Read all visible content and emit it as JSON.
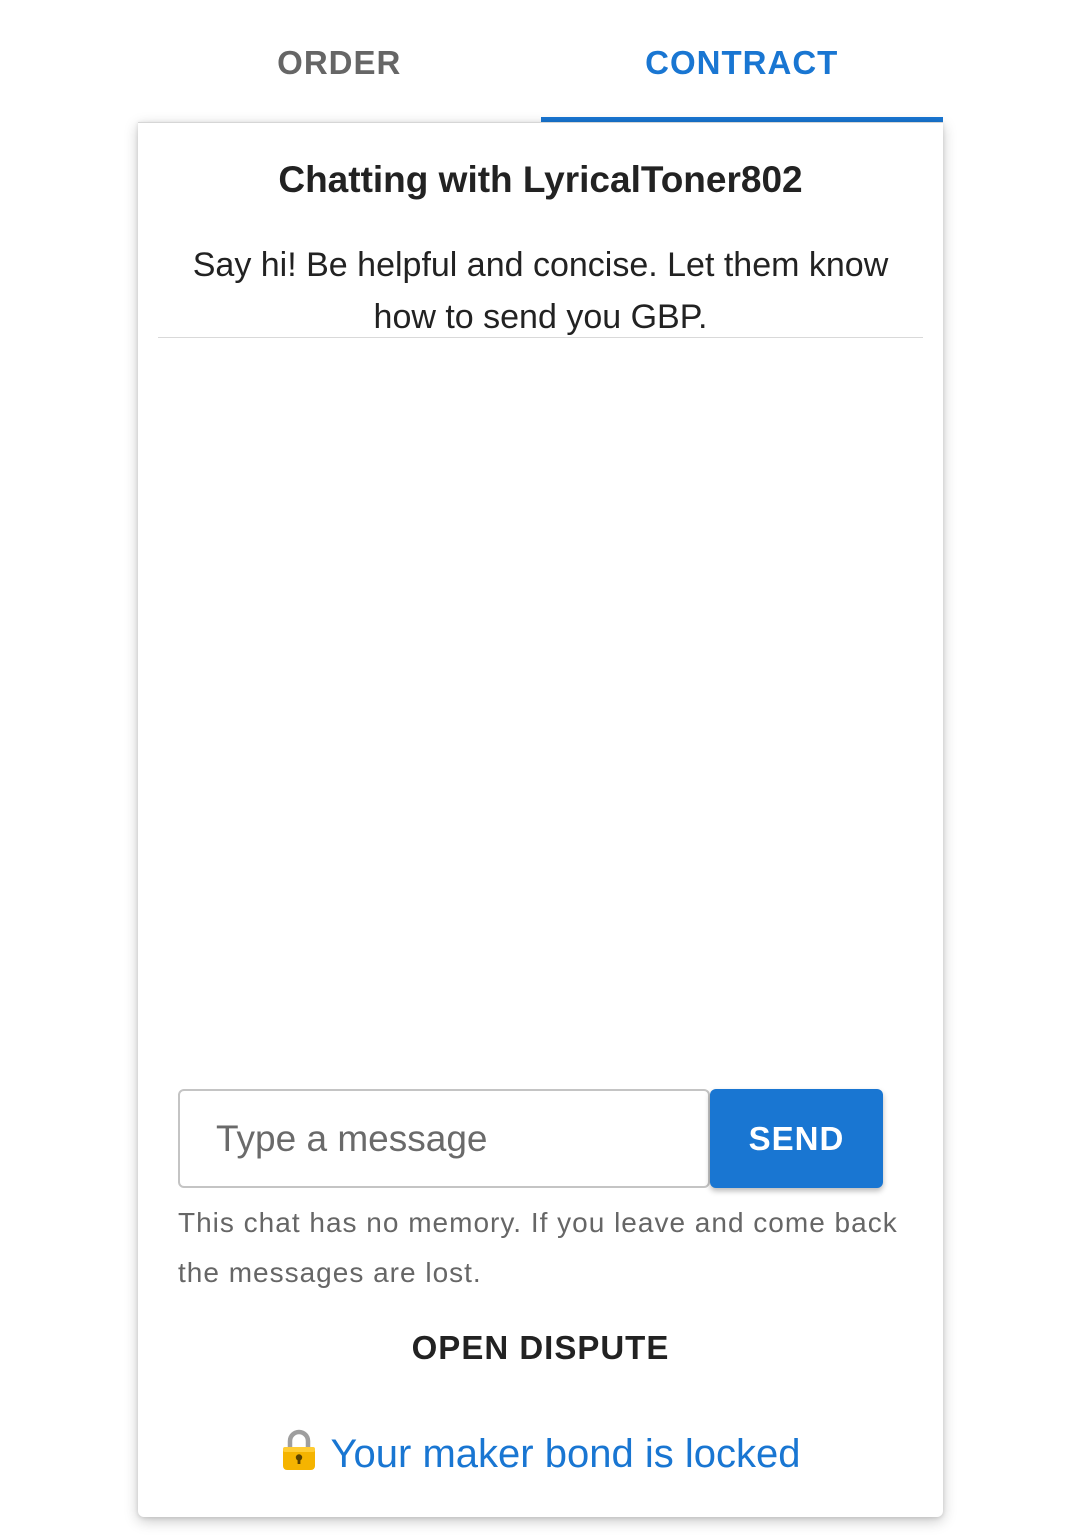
{
  "tabs": [
    {
      "label": "ORDER",
      "active": false
    },
    {
      "label": "CONTRACT",
      "active": true
    }
  ],
  "chat": {
    "title": "Chatting with LyricalToner802",
    "hint": "Say hi! Be helpful and concise. Let them know how to send you GBP.",
    "messages": [],
    "input_placeholder": "Type a message",
    "input_value": "",
    "send_label": "SEND",
    "memory_note": "This chat has no memory. If you leave and come back the messages are lost."
  },
  "actions": {
    "open_dispute_label": "OPEN DISPUTE"
  },
  "bond": {
    "icon": "lock-icon",
    "status_text": "Your maker bond is locked"
  },
  "colors": {
    "accent": "#1976d2",
    "inactive_tab": "#666666",
    "text": "#222222"
  }
}
